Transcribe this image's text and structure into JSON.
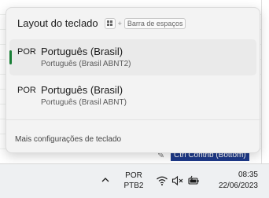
{
  "flyout": {
    "title": "Layout do teclado",
    "shortcut": {
      "plus": "+",
      "key_label": "Barra de espaços"
    },
    "items": [
      {
        "code": "POR",
        "name": "Português (Brasil)",
        "layout": "Português (Brasil ABNT2)",
        "selected": true
      },
      {
        "code": "POR",
        "name": "Português (Brasil)",
        "layout": "Português (Brasil ABNT)",
        "selected": false
      }
    ],
    "more_settings": "Mais configurações de teclado"
  },
  "background": {
    "status_tag": "Ctrl Contrib (Bottom)"
  },
  "taskbar": {
    "ime_line1": "POR",
    "ime_line2": "PTB2",
    "time": "08:35",
    "date": "22/06/2023"
  },
  "colors": {
    "accent": "#1a7f37",
    "flyout_bg": "#f3f3f3",
    "taskbar_bg": "#eef0f2",
    "tag_bg": "#1e3a8a"
  }
}
